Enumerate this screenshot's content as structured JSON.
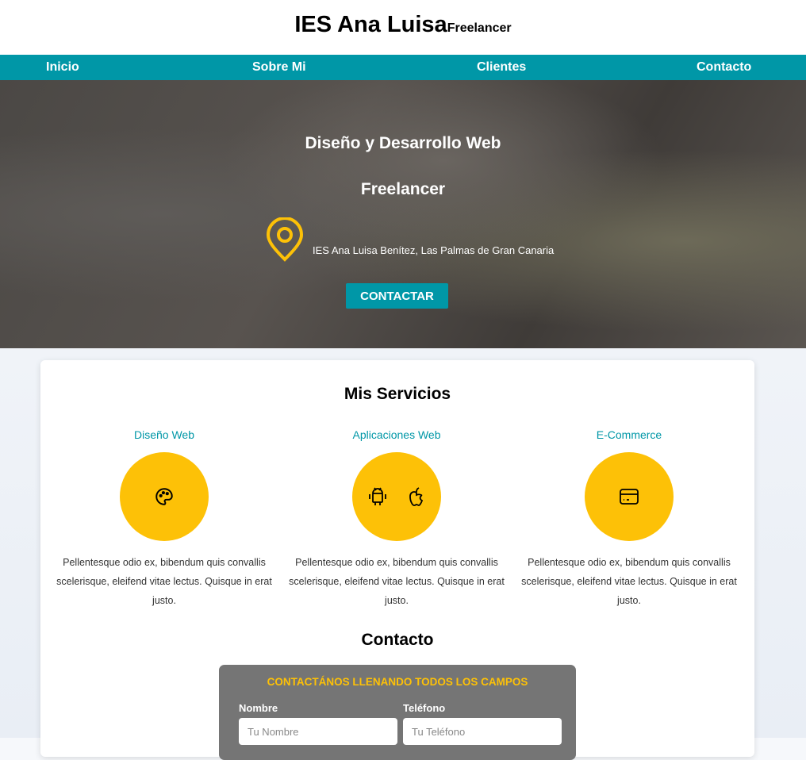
{
  "header": {
    "title": "IES Ana Luisa",
    "subtitle": "Freelancer"
  },
  "nav": [
    "Inicio",
    "Sobre Mi",
    "Clientes",
    "Contacto"
  ],
  "hero": {
    "line1": "Diseño y Desarrollo Web",
    "line2": "Freelancer",
    "location": "IES Ana Luisa Benítez, Las Palmas de Gran Canaria",
    "button": "CONTACTAR"
  },
  "services": {
    "title": "Mis Servicios",
    "items": [
      {
        "title": "Diseño Web",
        "text": "Pellentesque odio ex, bibendum quis convallis scelerisque, eleifend vitae lectus. Quisque in erat justo."
      },
      {
        "title": "Aplicaciones Web",
        "text": "Pellentesque odio ex, bibendum quis convallis scelerisque, eleifend vitae lectus. Quisque in erat justo."
      },
      {
        "title": "E-Commerce",
        "text": "Pellentesque odio ex, bibendum quis convallis scelerisque, eleifend vitae lectus. Quisque in erat justo."
      }
    ]
  },
  "contact": {
    "title": "Contacto",
    "form_title": "CONTACTÁNOS LLENANDO TODOS LOS CAMPOS",
    "name_label": "Nombre",
    "name_placeholder": "Tu Nombre",
    "phone_label": "Teléfono",
    "phone_placeholder": "Tu Teléfono"
  },
  "colors": {
    "accent": "#0097a7",
    "yellow": "#fdc107"
  }
}
